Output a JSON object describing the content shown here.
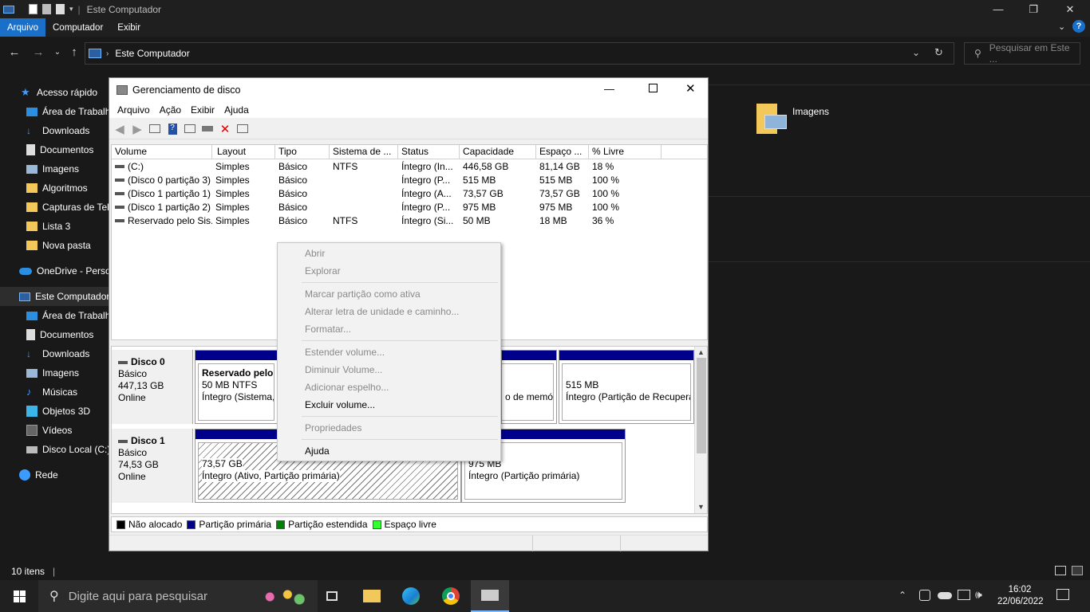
{
  "explorer": {
    "title": "Este Computador",
    "ribbon_tabs": [
      "Arquivo",
      "Computador",
      "Exibir"
    ],
    "address": "Este Computador",
    "search_placeholder": "Pesquisar em Este ...",
    "sidebar": {
      "quick_access": "Acesso rápido",
      "quick_items": [
        "Área de Trabalho",
        "Downloads",
        "Documentos",
        "Imagens",
        "Algoritmos",
        "Capturas de Tela",
        "Lista 3",
        "Nova pasta"
      ],
      "onedrive": "OneDrive - Personal",
      "this_pc": "Este Computador",
      "pc_items": [
        "Área de Trabalho",
        "Documentos",
        "Downloads",
        "Imagens",
        "Músicas",
        "Objetos 3D",
        "Vídeos",
        "Disco Local (C:)"
      ],
      "network": "Rede"
    },
    "folder_visible": "Imagens",
    "status_count": "10 itens"
  },
  "taskbar": {
    "search_placeholder": "Digite aqui para pesquisar",
    "time": "16:02",
    "date": "22/06/2022"
  },
  "diskmgmt": {
    "title": "Gerenciamento de disco",
    "menu": [
      "Arquivo",
      "Ação",
      "Exibir",
      "Ajuda"
    ],
    "columns": [
      "Volume",
      "Layout",
      "Tipo",
      "Sistema de ...",
      "Status",
      "Capacidade",
      "Espaço ...",
      "% Livre"
    ],
    "rows": [
      [
        "(C:)",
        "Simples",
        "Básico",
        "NTFS",
        "Íntegro (In...",
        "446,58 GB",
        "81,14 GB",
        "18 %"
      ],
      [
        "(Disco 0 partição 3)",
        "Simples",
        "Básico",
        "",
        "Íntegro (P...",
        "515 MB",
        "515 MB",
        "100 %"
      ],
      [
        "(Disco 1 partição 1)",
        "Simples",
        "Básico",
        "",
        "Íntegro (A...",
        "73,57 GB",
        "73,57 GB",
        "100 %"
      ],
      [
        "(Disco 1 partição 2)",
        "Simples",
        "Básico",
        "",
        "Íntegro (P...",
        "975 MB",
        "975 MB",
        "100 %"
      ],
      [
        "Reservado pelo Sis...",
        "Simples",
        "Básico",
        "NTFS",
        "Íntegro (Si...",
        "50 MB",
        "18 MB",
        "36 %"
      ]
    ],
    "disks": [
      {
        "name": "Disco 0",
        "type": "Básico",
        "size": "447,13 GB",
        "state": "Online",
        "p1_title": "Reservado pelo",
        "p1_line2": "50 MB NTFS",
        "p1_line3": "Íntegro (Sistema,",
        "p2_line3": "o de memó",
        "p3_line2": "515 MB",
        "p3_line3": "Íntegro (Partição de Recupera"
      },
      {
        "name": "Disco 1",
        "type": "Básico",
        "size": "74,53 GB",
        "state": "Online",
        "p1_line2": "73,57 GB",
        "p1_line3": "Íntegro (Ativo, Partição primária)",
        "p2_line2": "975 MB",
        "p2_line3": "Íntegro (Partição primária)"
      }
    ],
    "legend": [
      {
        "label": "Não alocado",
        "color": "#000000"
      },
      {
        "label": "Partição primária",
        "color": "#00008b"
      },
      {
        "label": "Partição estendida",
        "color": "#008000"
      },
      {
        "label": "Espaço livre",
        "color": "#33ff33"
      }
    ],
    "context_menu": {
      "open": "Abrir",
      "explore": "Explorar",
      "mark_active": "Marcar partição como ativa",
      "change_letter": "Alterar letra de unidade e caminho...",
      "format": "Formatar...",
      "extend": "Estender volume...",
      "shrink": "Diminuir Volume...",
      "add_mirror": "Adicionar espelho...",
      "delete": "Excluir volume...",
      "properties": "Propriedades",
      "help": "Ajuda"
    }
  }
}
